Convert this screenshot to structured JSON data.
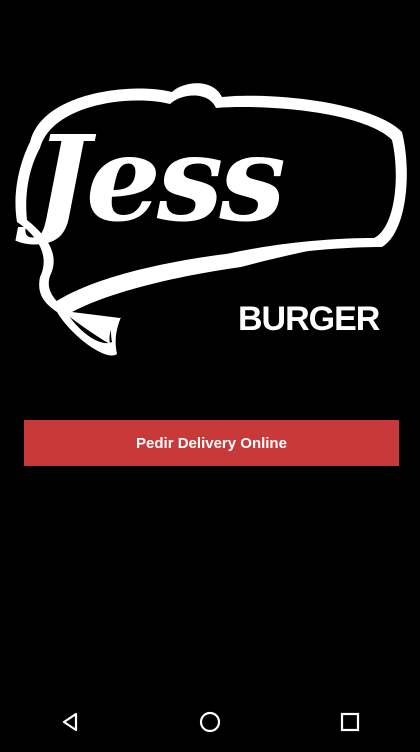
{
  "app": {
    "logo": {
      "wordmark": "Jess",
      "subtitle": "BURGER"
    }
  },
  "main": {
    "cta_label": "Pedir Delivery Online",
    "cta_color": "#c8393a"
  },
  "navbar": {
    "items": [
      {
        "icon": "back-triangle-icon"
      },
      {
        "icon": "home-circle-icon"
      },
      {
        "icon": "recents-square-icon"
      }
    ]
  }
}
